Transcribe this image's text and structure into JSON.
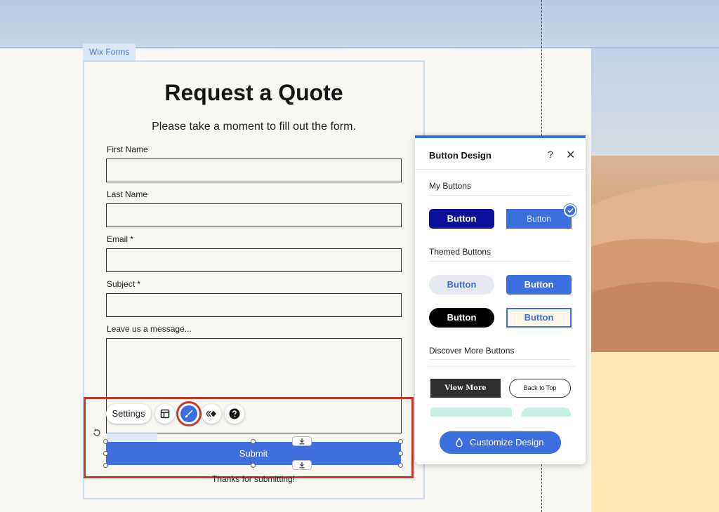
{
  "form": {
    "tag_label": "Wix Forms",
    "title": "Request a Quote",
    "subtitle": "Please take a moment to fill out the form.",
    "fields": [
      {
        "label": "First Name"
      },
      {
        "label": "Last Name"
      },
      {
        "label": "Email *"
      },
      {
        "label": "Subject *"
      },
      {
        "label": "Leave us a message..."
      }
    ],
    "submit_label": "Submit",
    "thanks_text": "Thanks for submitting!"
  },
  "toolbar": {
    "settings_label": "Settings",
    "icons": [
      "layout-icon",
      "brush-icon",
      "animation-icon",
      "help-icon"
    ]
  },
  "panel": {
    "title": "Button Design",
    "help_glyph": "?",
    "close_glyph": "✕",
    "my_buttons_label": "My Buttons",
    "themed_buttons_label": "Themed Buttons",
    "discover_label": "Discover More Buttons",
    "my_buttons": [
      "Button",
      "Button"
    ],
    "themed_buttons": [
      "Button",
      "Button",
      "Button",
      "Button"
    ],
    "discover_buttons": [
      "View More",
      "Back to Top"
    ],
    "customize_label": "Customize Design",
    "accent_color": "#3b6fe0"
  }
}
